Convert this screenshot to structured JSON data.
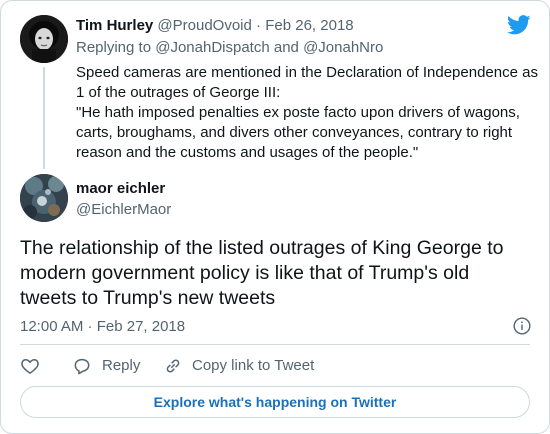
{
  "parent_tweet": {
    "display_name": "Tim Hurley",
    "handle": "@ProudOvoid",
    "separator": "·",
    "date": "Feb 26, 2018",
    "replying_to_prefix": "Replying to",
    "replying_to_1": "@JonahDispatch",
    "replying_to_and": "and",
    "replying_to_2": "@JonahNro",
    "text_line_1": "Speed cameras are mentioned in the Declaration of Independence as 1 of the outrages of George III:",
    "text_line_2": "\"He hath imposed penalties ex poste facto upon drivers of wagons, carts, broughams, and divers other conveyances, contrary to right reason and the customs and usages of the people.\""
  },
  "main_tweet": {
    "display_name": "maor eichler",
    "handle": "@EichlerMaor",
    "text": "The relationship of the listed outrages of King George to modern government policy is like that of Trump's old tweets to Trump's new tweets",
    "timestamp": "12:00 AM · Feb 27, 2018"
  },
  "actions": {
    "like_icon": "heart-icon",
    "reply_label": "Reply",
    "copy_label": "Copy link to Tweet"
  },
  "footer": {
    "explore_label": "Explore what's happening on Twitter"
  },
  "colors": {
    "brand_blue": "#1d9bf0",
    "link_blue": "#1d70b8",
    "muted": "#536471",
    "border": "#cfd9de"
  }
}
